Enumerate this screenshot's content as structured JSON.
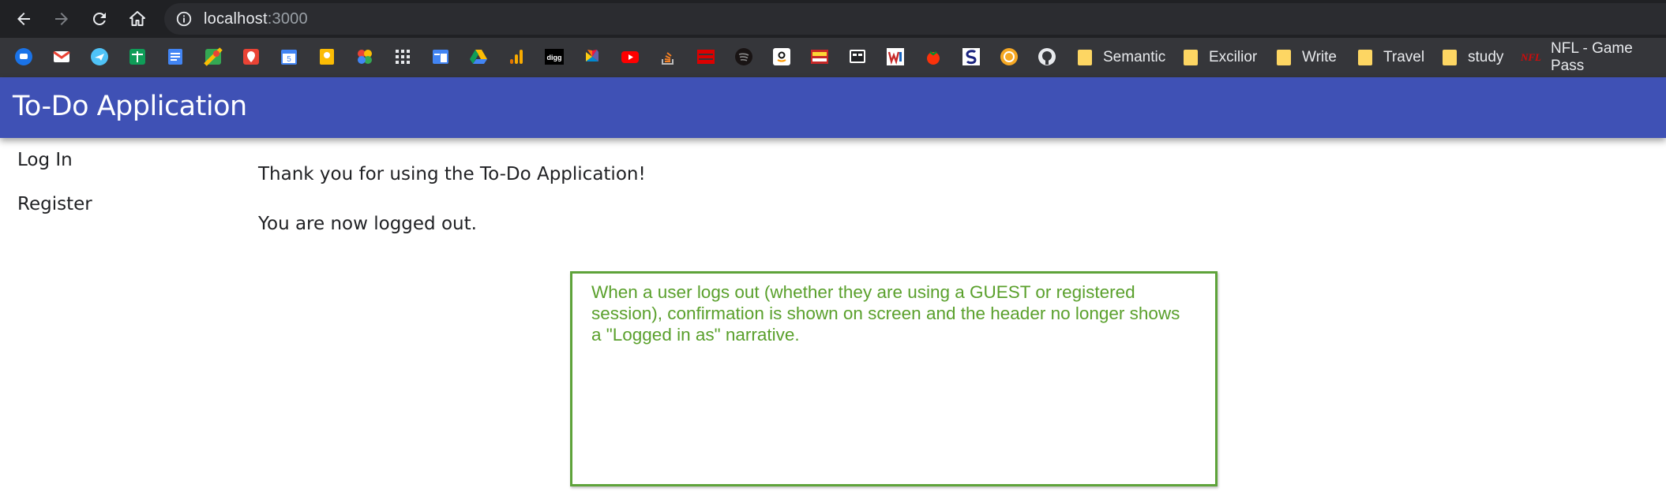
{
  "browser": {
    "url_host": "localhost",
    "url_port": ":3000",
    "bookmarks_icons": [
      "bluetooth-app-icon",
      "gmail-icon",
      "flights-icon",
      "sheets-icon",
      "docs-icon",
      "maps-icon",
      "location-pin-icon",
      "calendar-icon",
      "keep-icon",
      "photos-icon",
      "apps-grid-icon",
      "translate-icon",
      "drive-icon",
      "analytics-icon",
      "digg-icon",
      "nbc-icon",
      "youtube-icon",
      "stackoverflow-icon",
      "espn-icon",
      "spotify-icon",
      "amazon-icon",
      "news-icon",
      "reader-icon",
      "weather-icon",
      "tomato-icon",
      "s-icon",
      "coin-icon",
      "github-icon"
    ],
    "calendar_day": "5",
    "digg_label": "digg",
    "bookmark_folders": [
      {
        "label": "Semantic"
      },
      {
        "label": "Excilior"
      },
      {
        "label": "Write"
      },
      {
        "label": "Travel"
      },
      {
        "label": "study"
      }
    ],
    "nfl_bookmark": {
      "label": "NFL - Game Pass",
      "badge": "NFL"
    }
  },
  "app": {
    "title": "To-Do Application",
    "accent_color": "#3f51b5",
    "nav": [
      {
        "label": "Log In"
      },
      {
        "label": "Register"
      }
    ],
    "messages": {
      "thanks": "Thank you for using the To-Do Application!",
      "logged_out": "You are now logged out."
    }
  },
  "annotation": {
    "text": "When a user logs out (whether they are using a GUEST or registered session), confirmation is shown on screen and the header no longer shows a \"Logged in as\" narrative.",
    "color": "#5ea33a"
  }
}
